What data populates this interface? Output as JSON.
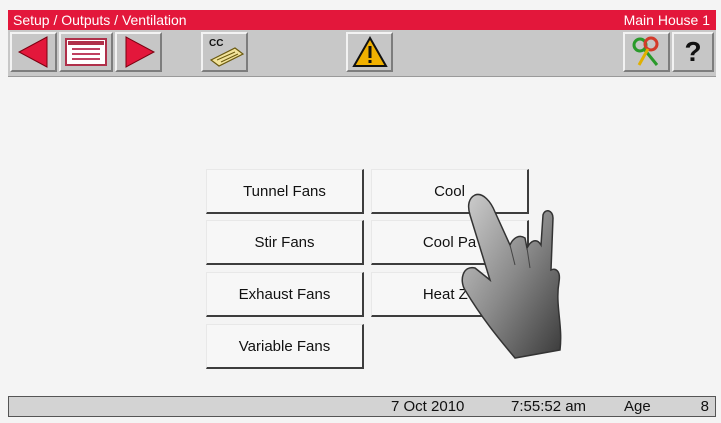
{
  "header": {
    "breadcrumb": "Setup / Outputs / Ventilation",
    "house": "Main House 1"
  },
  "toolbar": {
    "cc_label": "CC",
    "help_label": "?",
    "icons": [
      "arrow-left-icon",
      "list-card-icon",
      "arrow-right-icon",
      "cc-keypad-icon",
      "warning-icon",
      "keys-icon",
      "help-icon"
    ]
  },
  "menu": {
    "tunnel_fans": "Tunnel Fans",
    "stir_fans": "Stir Fans",
    "exhaust_fans": "Exhaust Fans",
    "variable_fans": "Variable Fans",
    "cool": "Cool",
    "cool_pads": "Cool Pa",
    "heat_zones": "Heat Zo"
  },
  "status": {
    "date": "7 Oct 2010",
    "time": "7:55:52 am",
    "age_label": "Age",
    "age_value": "8"
  },
  "colors": {
    "title_bar": "#e3173b",
    "arrow": "#e3173b",
    "warning": "#f0b000"
  }
}
